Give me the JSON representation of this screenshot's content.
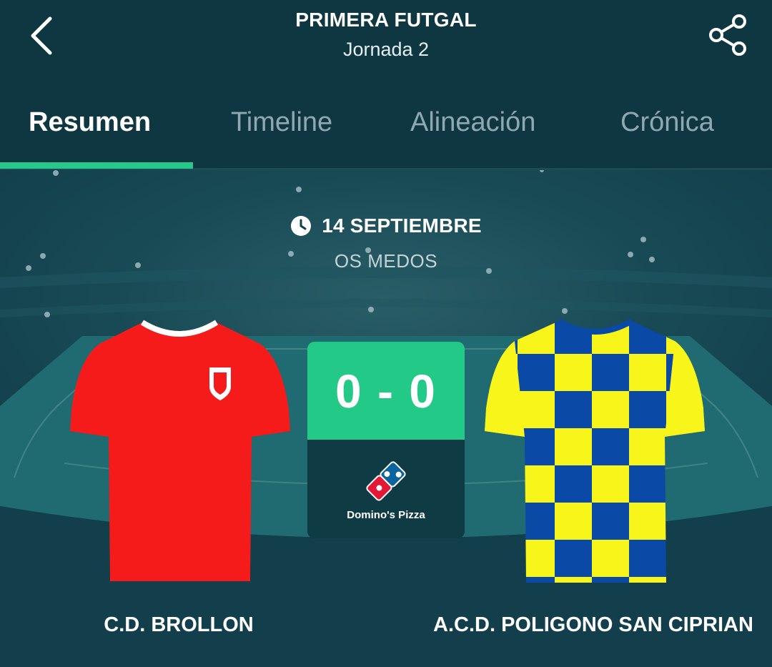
{
  "header": {
    "competition": "PRIMERA FUTGAL",
    "round": "Jornada 2",
    "back_icon": "chevron-left-icon",
    "share_icon": "share-icon"
  },
  "tabs": [
    {
      "label": "Resumen",
      "active": true
    },
    {
      "label": "Timeline",
      "active": false
    },
    {
      "label": "Alineación",
      "active": false
    },
    {
      "label": "Crónica",
      "active": false
    }
  ],
  "match": {
    "date": "14 SEPTIEMBRE",
    "venue": "OS MEDOS",
    "score": "0 - 0",
    "sponsor": "Domino's Pizza",
    "home_team": "C.D. BROLLON",
    "away_team": "A.C.D. POLIGONO SAN CIPRIAN"
  },
  "colors": {
    "accent": "#27c98a",
    "background": "#0e3742",
    "home_shirt": "#f61b1b",
    "away_shirt_yellow": "#f7f51a",
    "away_shirt_blue": "#0a4aa6"
  }
}
